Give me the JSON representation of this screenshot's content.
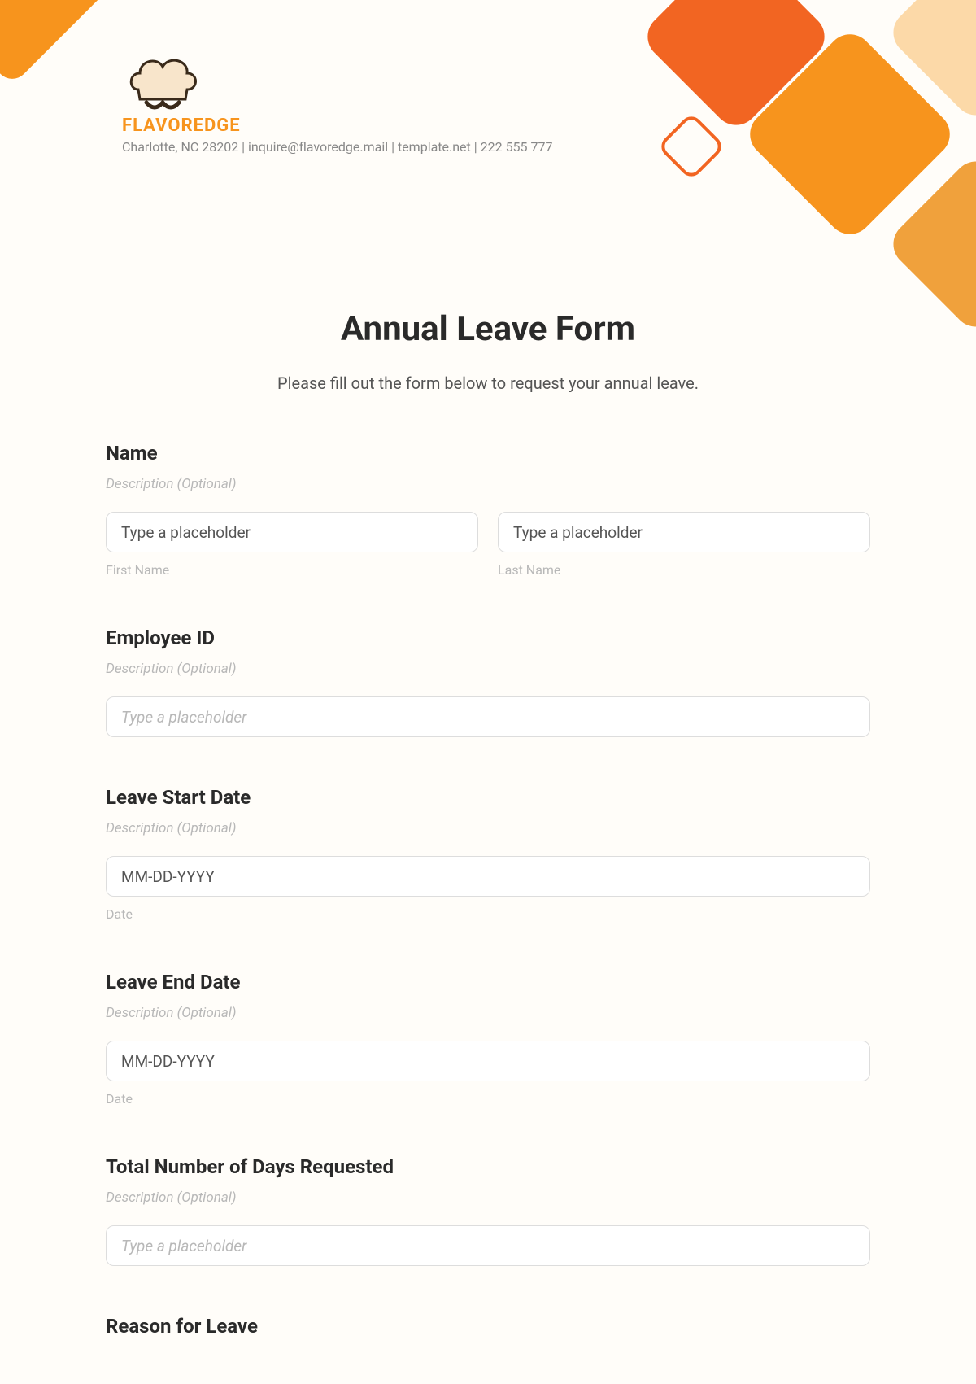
{
  "brand": "FLAVOREDGE",
  "contact_line": "Charlotte, NC 28202 | inquire@flavoredge.mail | template.net | 222 555 777",
  "form": {
    "title": "Annual Leave Form",
    "subtitle": "Please fill out the form below to request your annual leave.",
    "desc_placeholder": "Description (Optional)",
    "type_placeholder": "Type a placeholder",
    "date_placeholder": "MM-DD-YYYY",
    "sub_date": "Date",
    "fields": {
      "name": {
        "label": "Name",
        "first_sub": "First Name",
        "last_sub": "Last Name"
      },
      "employee_id": {
        "label": "Employee ID"
      },
      "start_date": {
        "label": "Leave Start Date"
      },
      "end_date": {
        "label": "Leave End Date"
      },
      "total_days": {
        "label": "Total Number of Days Requested"
      },
      "reason": {
        "label": "Reason for Leave"
      }
    }
  }
}
